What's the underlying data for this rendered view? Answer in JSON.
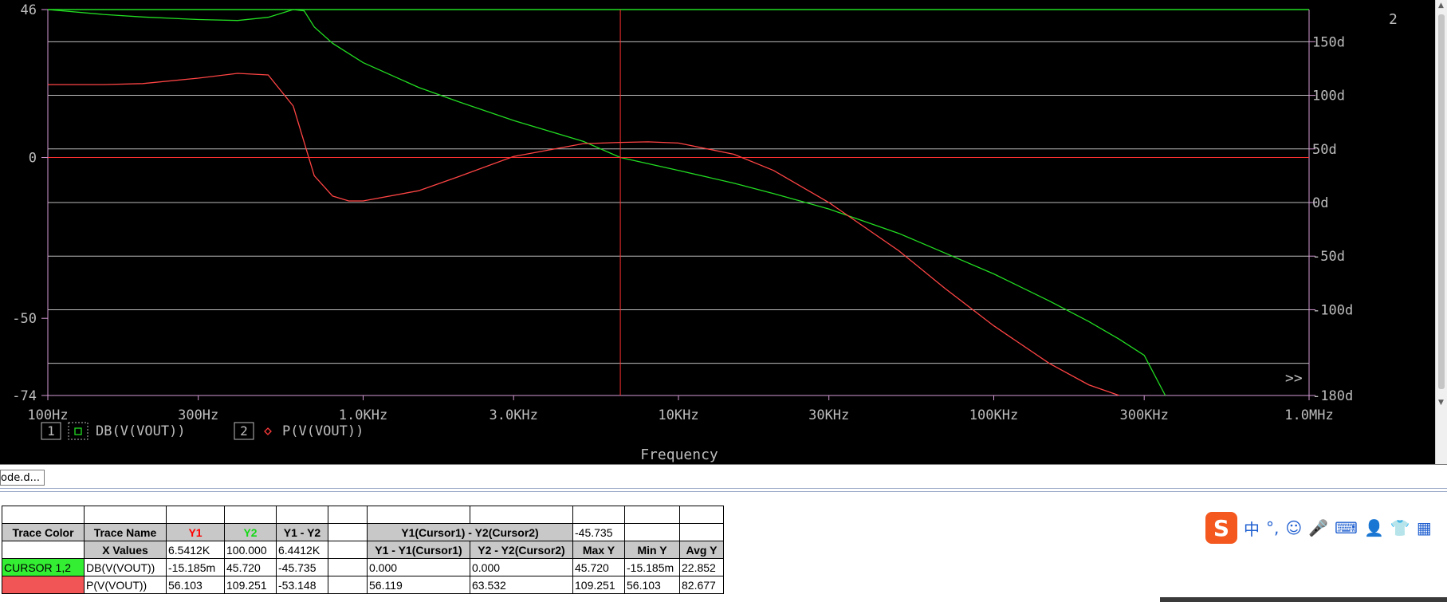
{
  "plot": {
    "left_axis_ticks": [
      {
        "label": "46",
        "value": 46
      },
      {
        "label": "0",
        "value": 0
      },
      {
        "label": "-50",
        "value": -50
      },
      {
        "label": "-74",
        "value": -74
      }
    ],
    "right_axis_ticks": [
      {
        "label": "150d",
        "value": 150
      },
      {
        "label": "100d",
        "value": 100
      },
      {
        "label": "50d",
        "value": 50
      },
      {
        "label": "0d",
        "value": 0
      },
      {
        "label": "-50d",
        "value": -50
      },
      {
        "label": "-100d",
        "value": -100
      },
      {
        "label": "-180d",
        "value": -180
      }
    ],
    "x_ticks": [
      "100Hz",
      "300Hz",
      "1.0KHz",
      "3.0KHz",
      "10KHz",
      "30KHz",
      "100KHz",
      "300KHz",
      "1.0MHz"
    ],
    "x_axis_label": "Frequency",
    "plot_number": "2",
    "more_marker": ">>",
    "legend": [
      {
        "index": "1",
        "symbol": "square",
        "trace": "DB(V(VOUT))",
        "color": "#22dd22"
      },
      {
        "index": "2",
        "symbol": "diamond",
        "trace": "P(V(VOUT))",
        "color": "#ff3a3a"
      }
    ],
    "colors": {
      "background": "#000000",
      "grid": "#bdbdbd",
      "axis": "#d39ad3",
      "db_trace": "#22dd22",
      "phase_trace": "#ff4444",
      "cursor": "#ff3030",
      "text": "#bdbdbd"
    }
  },
  "chart_data": {
    "type": "line",
    "x_scale": "log",
    "x_unit": "Hz",
    "xlim": [
      100,
      1000000
    ],
    "y_left_lim": [
      -74,
      46
    ],
    "y_right_lim": [
      -180,
      180
    ],
    "xlabel": "Frequency",
    "series": [
      {
        "name": "DB(V(VOUT))",
        "axis": "left",
        "x": [
          100,
          150,
          200,
          300,
          400,
          500,
          600,
          650,
          700,
          800,
          1000,
          1500,
          2000,
          3000,
          5000,
          6541,
          10000,
          15000,
          20000,
          30000,
          50000,
          70000,
          100000,
          150000,
          200000,
          250000,
          300000,
          350000
        ],
        "values": [
          46,
          44.5,
          43.7,
          42.9,
          42.6,
          43.6,
          46,
          45.6,
          40.6,
          35.5,
          29.5,
          21.8,
          17.4,
          11.5,
          5.0,
          0.0,
          -4.0,
          -8.0,
          -11.2,
          -16.0,
          -23.6,
          -29.7,
          -36.2,
          -44.6,
          -51.0,
          -56.5,
          -61.5,
          -74
        ]
      },
      {
        "name": "P(V(VOUT))",
        "axis": "right",
        "x": [
          100,
          150,
          200,
          300,
          400,
          500,
          600,
          700,
          800,
          900,
          1000,
          1500,
          2000,
          3000,
          5000,
          6541,
          8000,
          10000,
          15000,
          20000,
          30000,
          50000,
          70000,
          100000,
          150000,
          200000,
          250000
        ],
        "values": [
          110,
          110,
          111,
          116,
          120.5,
          119,
          90,
          25,
          6,
          1.5,
          1.5,
          11,
          24,
          43,
          55,
          56.103,
          56.6,
          55.5,
          45,
          30,
          0,
          -45,
          -80,
          -115,
          -150,
          -170,
          -180
        ]
      }
    ],
    "cursors": {
      "x": 6541.2,
      "y_left": 0
    }
  },
  "tab": {
    "label": "ode.d..."
  },
  "cursor_table": {
    "head": {
      "trace_color": "Trace Color",
      "trace_name": "Trace Name",
      "y1": "Y1",
      "y2": "Y2",
      "y1_y2": "Y1 - Y2",
      "cursor_diff": "Y1(Cursor1) - Y2(Cursor2)",
      "cursor_diff_val": "-45.735"
    },
    "sub": {
      "x_values": "X Values",
      "y1": "6.5412K",
      "y2": "100.000",
      "y1_y2": "6.4412K",
      "c1": "Y1 - Y1(Cursor1)",
      "c2": "Y2 - Y2(Cursor2)",
      "max": "Max Y",
      "min": "Min Y",
      "avg": "Avg Y"
    },
    "rows": [
      {
        "color_label": "CURSOR 1,2",
        "name": "DB(V(VOUT))",
        "y1": "-15.185m",
        "y2": "45.720",
        "d": "-45.735",
        "c1": "0.000",
        "c2": "0.000",
        "max": "45.720",
        "min": "-15.185m",
        "avg": "22.852"
      },
      {
        "color_label": "",
        "name": "P(V(VOUT))",
        "y1": "56.103",
        "y2": "109.251",
        "d": "-53.148",
        "c1": "56.119",
        "c2": "63.532",
        "max": "109.251",
        "min": "56.103",
        "avg": "82.677"
      }
    ]
  },
  "ime": {
    "logo": "S",
    "items": [
      {
        "glyph": "中",
        "name": "chinese-mode-icon"
      },
      {
        "glyph": "°,",
        "name": "punctuation-icon"
      },
      {
        "glyph": "☺",
        "name": "emoji-icon"
      },
      {
        "glyph": "🎤",
        "name": "microphone-icon"
      },
      {
        "glyph": "⌨",
        "name": "keyboard-icon"
      },
      {
        "glyph": "👤",
        "name": "user-icon"
      },
      {
        "glyph": "👕",
        "name": "skin-icon"
      },
      {
        "glyph": "▦",
        "name": "grid-menu-icon"
      }
    ]
  }
}
